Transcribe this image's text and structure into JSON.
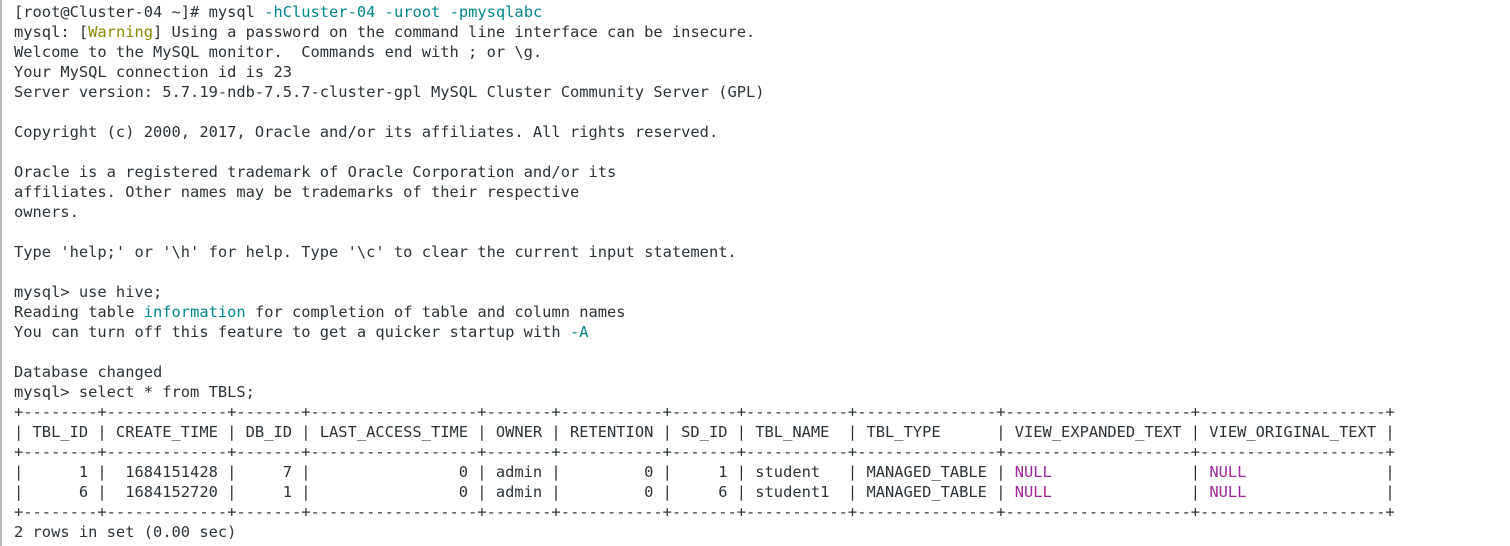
{
  "terminal": {
    "kind": "mysql-client-session",
    "background_color": "#ffffff",
    "foreground_color": "#2b3338",
    "accent_colors": {
      "teal": "#00868a",
      "olive": "#8a8a00",
      "magenta": "#a0269e"
    },
    "prompt_shell": "[root@Cluster-04 ~]#",
    "prompt_mysql": "mysql>"
  },
  "lines": {
    "l01_prompt": "[root@Cluster-04 ~]# mysql ",
    "l01_flag_h": "-hCluster-04",
    "l01_space1": " ",
    "l01_flag_u": "-uroot",
    "l01_space2": " ",
    "l01_flag_p": "-pmysqlabc",
    "l02_a": "mysql: [",
    "l02_warning": "Warning",
    "l02_b": "] Using a password on the command line interface can be insecure.",
    "l03": "Welcome to the MySQL monitor.  Commands end with ; or \\g.",
    "l04": "Your MySQL connection id is 23",
    "l05": "Server version: 5.7.19-ndb-7.5.7-cluster-gpl MySQL Cluster Community Server (GPL)",
    "l07": "Copyright (c) 2000, 2017, Oracle and/or its affiliates. All rights reserved.",
    "l09": "Oracle is a registered trademark of Oracle Corporation and/or its",
    "l10": "affiliates. Other names may be trademarks of their respective",
    "l11": "owners.",
    "l13": "Type 'help;' or '\\h' for help. Type '\\c' to clear the current input statement.",
    "l15": "mysql> use hive;",
    "l16_a": "Reading table ",
    "l16_info": "information",
    "l16_b": " for completion of table and column names",
    "l17_a": "You can turn off this feature to get a quicker startup with ",
    "l17_flag": "-A",
    "l19": "Database changed",
    "l20": "mysql> select * from TBLS;",
    "l_footer": "2 rows in set (0.00 sec)"
  },
  "query": {
    "statement": "select * from TBLS;",
    "database": "hive",
    "result_summary": "2 rows in set (0.00 sec)",
    "row_count": 2,
    "elapsed_seconds": "0.00"
  },
  "result_table": {
    "rule_top": "+--------+-------------+-------+------------------+-------+-----------+-------+-----------+---------------+--------------------+--------------------+",
    "header_row": "| TBL_ID | CREATE_TIME | DB_ID | LAST_ACCESS_TIME | OWNER | RETENTION | SD_ID | TBL_NAME  | TBL_TYPE      | VIEW_EXPANDED_TEXT | VIEW_ORIGINAL_TEXT |",
    "rule_mid": "+--------+-------------+-------+------------------+-------+-----------+-------+-----------+---------------+--------------------+--------------------+",
    "rule_bottom": "+--------+-------------+-------+------------------+-------+-----------+-------+-----------+---------------+--------------------+--------------------+",
    "columns": [
      "TBL_ID",
      "CREATE_TIME",
      "DB_ID",
      "LAST_ACCESS_TIME",
      "OWNER",
      "RETENTION",
      "SD_ID",
      "TBL_NAME",
      "TBL_TYPE",
      "VIEW_EXPANDED_TEXT",
      "VIEW_ORIGINAL_TEXT"
    ],
    "rows": [
      {
        "prefix": "|      1 |  1684151428 |     7 |                0 | admin |         0 |     1 | student   | MANAGED_TABLE | ",
        "view_expanded_text": "NULL",
        "middle": "               | ",
        "view_original_text": "NULL",
        "suffix": "               |",
        "values": {
          "TBL_ID": "1",
          "CREATE_TIME": "1684151428",
          "DB_ID": "7",
          "LAST_ACCESS_TIME": "0",
          "OWNER": "admin",
          "RETENTION": "0",
          "SD_ID": "1",
          "TBL_NAME": "student",
          "TBL_TYPE": "MANAGED_TABLE",
          "VIEW_EXPANDED_TEXT": "NULL",
          "VIEW_ORIGINAL_TEXT": "NULL"
        }
      },
      {
        "prefix": "|      6 |  1684152720 |     1 |                0 | admin |         0 |     6 | student1  | MANAGED_TABLE | ",
        "view_expanded_text": "NULL",
        "middle": "               | ",
        "view_original_text": "NULL",
        "suffix": "               |",
        "values": {
          "TBL_ID": "6",
          "CREATE_TIME": "1684152720",
          "DB_ID": "1",
          "LAST_ACCESS_TIME": "0",
          "OWNER": "admin",
          "RETENTION": "0",
          "SD_ID": "6",
          "TBL_NAME": "student1",
          "TBL_TYPE": "MANAGED_TABLE",
          "VIEW_EXPANDED_TEXT": "NULL",
          "VIEW_ORIGINAL_TEXT": "NULL"
        }
      }
    ]
  }
}
